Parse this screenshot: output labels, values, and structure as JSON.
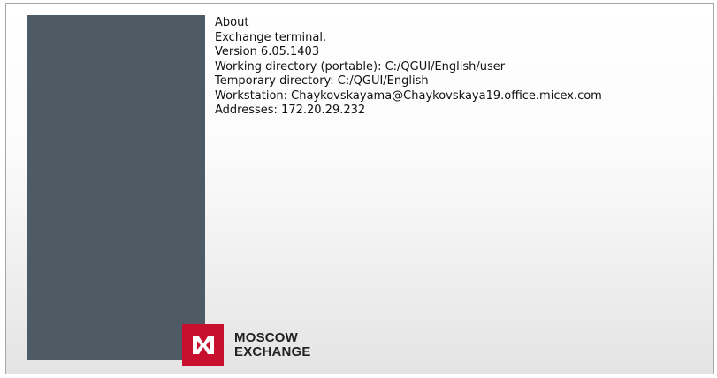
{
  "about": {
    "title": "About",
    "product": "Exchange terminal.",
    "version": "Version 6.05.1403",
    "working_directory": "Working directory (portable): C:/QGUI/English/user",
    "temporary_directory": "Temporary directory: C:/QGUI/English",
    "workstation": "Workstation: Chaykovskayama@Chaykovskaya19.office.micex.com",
    "addresses": "Addresses: 172.20.29.232"
  },
  "logo": {
    "line1": "MOSCOW",
    "line2": "EXCHANGE",
    "brand_color": "#c8102e",
    "icon": "moscow-exchange-logo-icon"
  },
  "colors": {
    "side_panel": "#4f5b64"
  }
}
